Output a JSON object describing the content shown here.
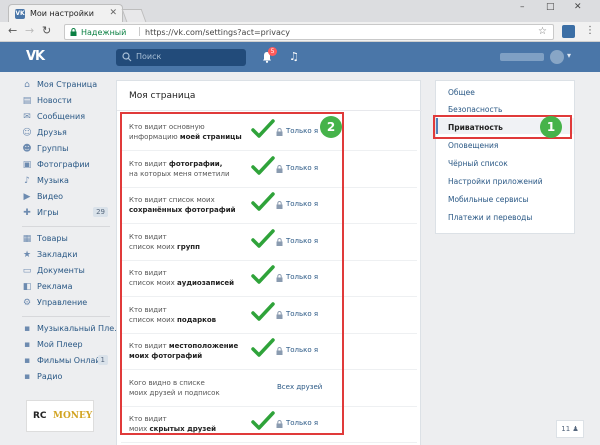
{
  "browser": {
    "tab_title": "Мои настройки",
    "tab_favicon": "vk-favicon",
    "secure_label": "Надежный",
    "url": "https://vk.com/settings?act=privacy",
    "window_controls": [
      "–",
      "□",
      "✕"
    ]
  },
  "header": {
    "logo": "VK",
    "search_placeholder": "Поиск",
    "notifications_count": "5"
  },
  "sidebar": {
    "items": [
      {
        "label": "Моя Страница",
        "icon": "home-icon"
      },
      {
        "label": "Новости",
        "icon": "news-icon"
      },
      {
        "label": "Сообщения",
        "icon": "messages-icon"
      },
      {
        "label": "Друзья",
        "icon": "friends-icon"
      },
      {
        "label": "Группы",
        "icon": "groups-icon"
      },
      {
        "label": "Фотографии",
        "icon": "photos-icon"
      },
      {
        "label": "Музыка",
        "icon": "music-icon"
      },
      {
        "label": "Видео",
        "icon": "video-icon"
      },
      {
        "label": "Игры",
        "icon": "games-icon",
        "count": "29"
      },
      {
        "label": "Товары",
        "icon": "goods-icon"
      },
      {
        "label": "Закладки",
        "icon": "bookmarks-icon"
      },
      {
        "label": "Документы",
        "icon": "documents-icon"
      },
      {
        "label": "Реклама",
        "icon": "ads-icon"
      },
      {
        "label": "Управление",
        "icon": "manage-icon"
      },
      {
        "label": "Музыкальный Пле...",
        "icon": "app-icon"
      },
      {
        "label": "Мой Плеер",
        "icon": "app-icon"
      },
      {
        "label": "Фильмы Онлайн",
        "icon": "app-icon",
        "count": "1"
      },
      {
        "label": "Радио",
        "icon": "app-icon"
      }
    ],
    "ad": {
      "part1": "RC",
      "part2": "MONEY"
    }
  },
  "main": {
    "title": "Моя страница",
    "rows": [
      {
        "line1": "Кто видит основную",
        "line2_pre": "информацию ",
        "line2_bold": "моей страницы",
        "value": "Только я",
        "checked": true
      },
      {
        "line1_pre": "Кто видит ",
        "line1_bold": "фотографии,",
        "line2_pre": "на которых меня отметили",
        "line2_bold": "",
        "value": "Только я",
        "checked": true
      },
      {
        "line1": "Кто видит список моих",
        "line2_pre": "",
        "line2_bold": "сохранённых фотографий",
        "value": "Только я",
        "checked": true
      },
      {
        "line1": "Кто видит",
        "line2_pre": "список моих ",
        "line2_bold": "групп",
        "value": "Только я",
        "checked": true
      },
      {
        "line1": "Кто видит",
        "line2_pre": "список моих ",
        "line2_bold": "аудиозаписей",
        "value": "Только я",
        "checked": true
      },
      {
        "line1": "Кто видит",
        "line2_pre": "список моих ",
        "line2_bold": "подарков",
        "value": "Только я",
        "checked": true
      },
      {
        "line1_pre": "Кто видит ",
        "line1_bold": "местоположение",
        "line2_pre": "",
        "line2_bold": "моих фотографий",
        "value": "Только я",
        "checked": true
      },
      {
        "line1": "Кого видно в списке",
        "line2_pre": "моих друзей и подписок",
        "line2_bold": "",
        "value": "Всех друзей",
        "checked": false
      },
      {
        "line1": "Кто видит",
        "line2_pre": "моих ",
        "line2_bold": "скрытых друзей",
        "value": "Только я",
        "checked": true
      }
    ]
  },
  "settings_menu": {
    "items": [
      "Общее",
      "Безопасность",
      "Приватность",
      "Оповещения",
      "Чёрный список",
      "Настройки приложений",
      "Мобильные сервисы",
      "Платежи и переводы"
    ],
    "active": "Приватность"
  },
  "annotations": {
    "badge1": "1",
    "badge2": "2"
  },
  "footer": {
    "counter": "11"
  },
  "colors": {
    "vk_blue": "#4a76a8",
    "link": "#2a5885",
    "highlight_red": "#e03a3a",
    "badge_green": "#46b34a",
    "check_green": "#2fa33a"
  }
}
